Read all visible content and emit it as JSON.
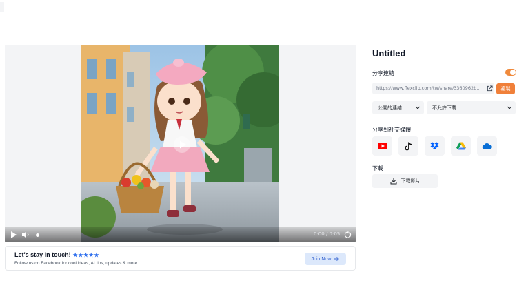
{
  "player": {
    "time": "0:00 / 0:05"
  },
  "promo": {
    "title": "Let's stay in touch!",
    "stars": "★★★★★",
    "subtitle": "Follow us on Facebook for cool ideas, AI tips, updates & more.",
    "join_label": "Join Now"
  },
  "panel": {
    "title": "Untitled",
    "share_link_label": "分享連結",
    "share_enabled": true,
    "link_url": "https://www.flexclip.com/tw/share/3360962bbc2307...",
    "copy_label": "複製",
    "visibility_select": "公開的連結",
    "download_select": "不允許下載",
    "social_label": "分享到社交媒體",
    "social_icons": [
      "youtube-icon",
      "tiktok-icon",
      "dropbox-icon",
      "google-drive-icon",
      "onedrive-icon"
    ],
    "download_label": "下載",
    "download_button": "下載影片"
  },
  "colors": {
    "accent_orange": "#f0803a",
    "link_blue": "#2f5fcf",
    "star_blue": "#2f6fed"
  }
}
